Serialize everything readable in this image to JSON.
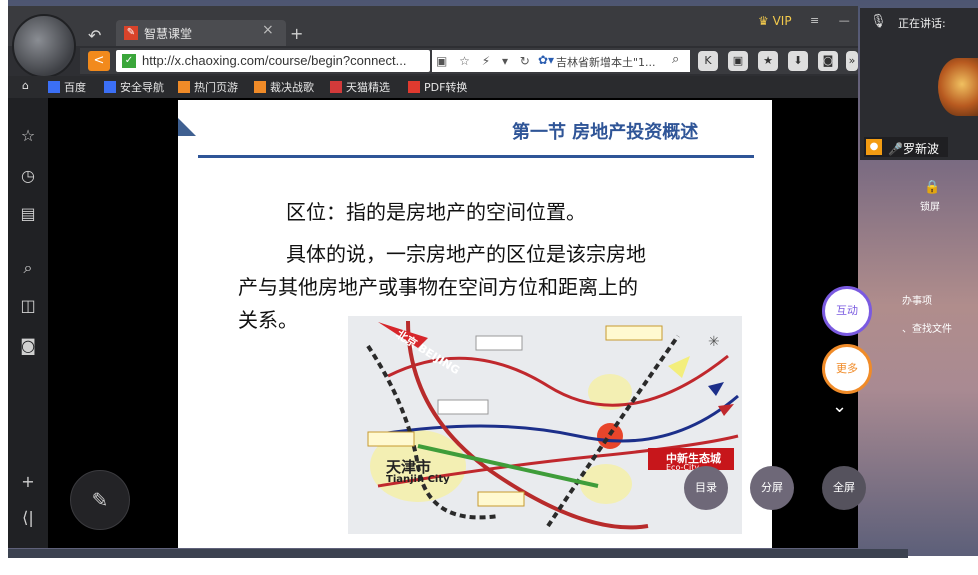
{
  "browser": {
    "tab_title": "智慧课堂",
    "url": "http://x.chaoxing.com/course/begin?connect...",
    "search_text": "吉林省新增本土\"1...",
    "vip_label": "VIP"
  },
  "bookmarks": [
    {
      "label": "百度",
      "color": "#3b6ff5"
    },
    {
      "label": "安全导航",
      "color": "#3b6ff5"
    },
    {
      "label": "热门页游",
      "color": "#f08b28"
    },
    {
      "label": "裁决战歌",
      "color": "#f08b28"
    },
    {
      "label": "天猫精选",
      "color": "#d23a3a"
    },
    {
      "label": "PDF转换",
      "color": "#e03a2f"
    }
  ],
  "slide": {
    "title": "第一节  房地产投资概述",
    "line1": "区位：指的是房地产的空间位置。",
    "line2": "具体的说，一宗房地产的区位是该宗房地",
    "line3": "产与其他房地产或事物在空间方位和距离上的",
    "line4": "关系。"
  },
  "map": {
    "label_beijing": "北京 BEIJING",
    "label_tianjin_cn": "天津市",
    "label_tianjin_en": "Tianjin City",
    "label_eco_city": "中新生态城",
    "label_eco_city_en": "Eco-City"
  },
  "webcam": {
    "speaking_label": "正在讲话:",
    "speaker_name": "罗新波"
  },
  "desktop": {
    "lock_label": "锁屏",
    "todo_label": "办事项",
    "find_file_label": "、查找文件"
  },
  "controls": {
    "interact": "互动",
    "more": "更多",
    "catalog": "目录",
    "split": "分屏",
    "fullscreen": "全屏"
  }
}
